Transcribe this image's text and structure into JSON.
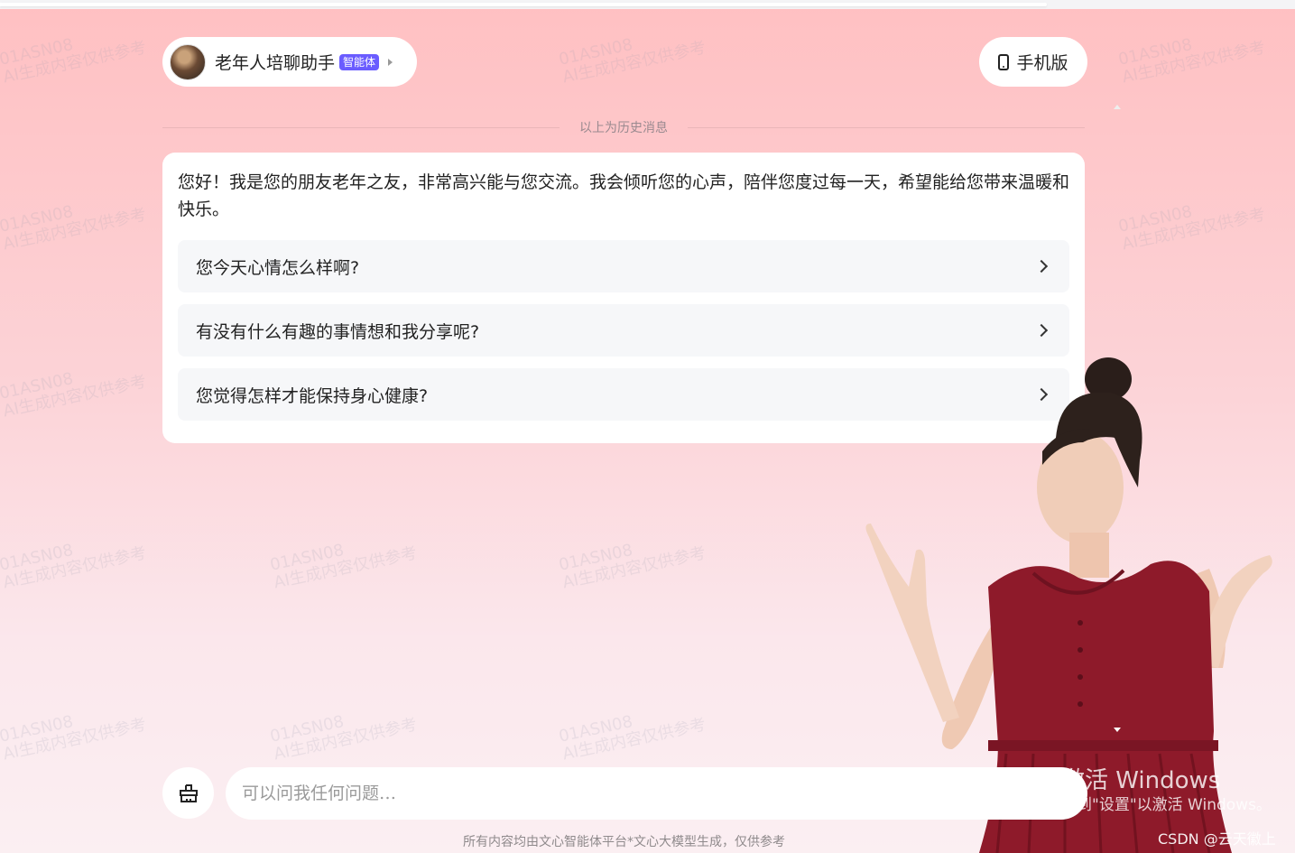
{
  "agent": {
    "name": "老年人培聊助手",
    "badge": "智能体"
  },
  "mobile_button": {
    "label": "手机版"
  },
  "history_divider": "以上为历史消息",
  "message": {
    "greeting": "您好！我是您的朋友老年之友，非常高兴能与您交流。我会倾听您的心声，陪伴您度过每一天，希望能给您带来温暖和快乐。",
    "suggestions": [
      {
        "text": "您今天心情怎么样啊?"
      },
      {
        "text": "有没有什么有趣的事情想和我分享呢?"
      },
      {
        "text": "您觉得怎样才能保持身心健康?"
      }
    ]
  },
  "input": {
    "placeholder": "可以问我任何问题…"
  },
  "footer_note": "所有内容均由文心智能体平台*文心大模型生成，仅供参考",
  "watermark": {
    "line1": "01ASN08",
    "line2": "AI生成内容仅供参考"
  },
  "os_overlay": {
    "activate_title": "激活 Windows",
    "activate_sub": "转到\"设置\"以激活 Windows。",
    "csdn": "CSDN @云天徽上"
  },
  "colors": {
    "badge": "#6a5cff",
    "background_top": "#ffc0c2",
    "background_bottom": "#fbeff2"
  },
  "icons": {
    "mobile": "phone-icon",
    "clear": "broom-icon",
    "agent_menu": "caret-right-icon",
    "suggestion": "chevron-right-icon"
  }
}
